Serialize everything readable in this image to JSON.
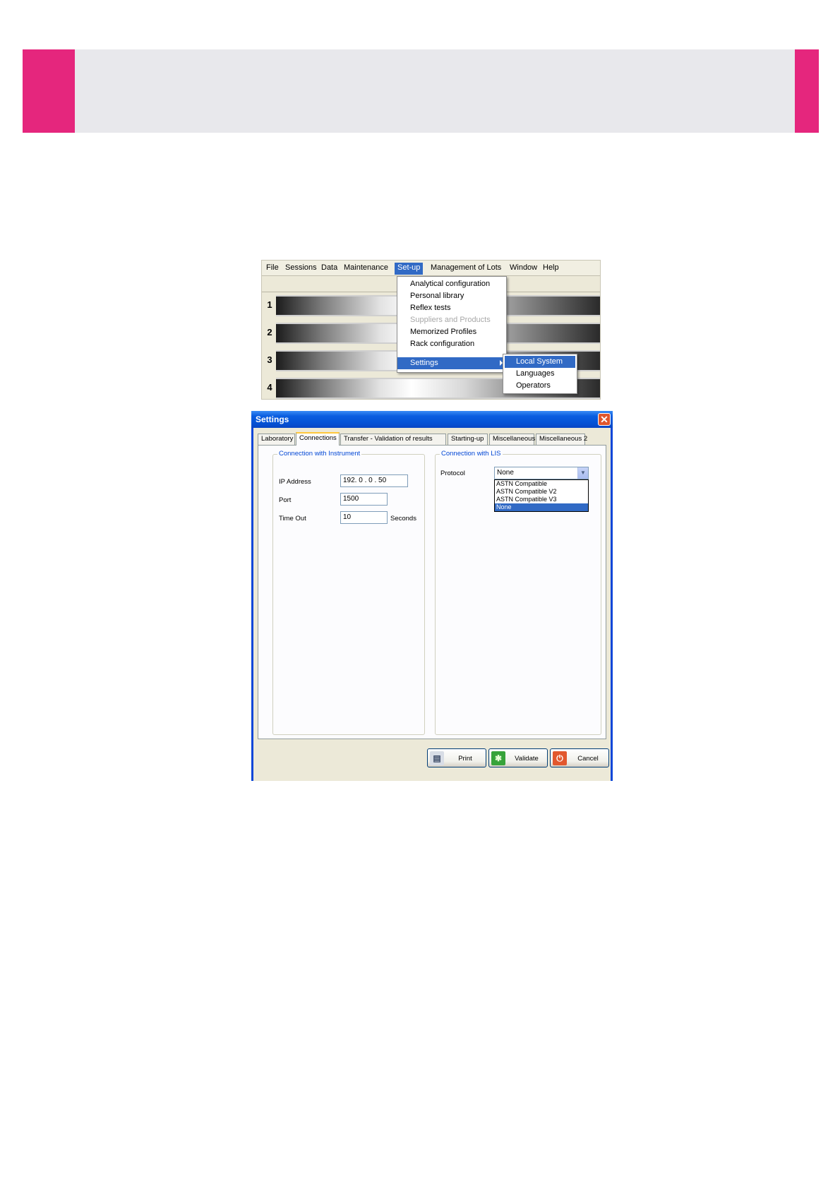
{
  "menubar": {
    "items": [
      "File",
      "Sessions",
      "Data",
      "Maintenance",
      "Set-up",
      "Management of Lots",
      "Window",
      "Help"
    ]
  },
  "setup_menu": {
    "items": [
      "Analytical configuration",
      "Personal library",
      "Reflex tests",
      "Suppliers and Products",
      "Memorized Profiles",
      "Rack configuration",
      "Settings"
    ]
  },
  "settings_submenu": {
    "items": [
      "Local System",
      "Languages",
      "Operators"
    ]
  },
  "racks": [
    "1",
    "2",
    "3",
    "4"
  ],
  "dialog": {
    "title": "Settings",
    "close_glyph": "✕",
    "tabs": [
      "Laboratory",
      "Connections",
      "Transfer - Validation of results",
      "Starting-up",
      "Miscellaneous",
      "Miscellaneous 2"
    ],
    "instrument": {
      "legend": "Connection with Instrument",
      "ip_label": "IP Address",
      "ip_value": "192.  0  .  0  .  50",
      "port_label": "Port",
      "port_value": "1500",
      "timeout_label": "Time Out",
      "timeout_value": "10",
      "timeout_unit": "Seconds"
    },
    "lis": {
      "legend": "Connection with LIS",
      "protocol_label": "Protocol",
      "protocol_value": "None",
      "protocol_options": [
        "ASTN Compatible",
        "ASTN Compatible V2",
        "ASTN Compatible V3",
        "None"
      ]
    },
    "buttons": {
      "print": "Print",
      "validate": "Validate",
      "cancel": "Cancel"
    }
  },
  "colors": {
    "accent": "#e5267d",
    "banner": "#e8e8ec",
    "xp_blue": "#0553d6",
    "highlight": "#316ac5"
  }
}
